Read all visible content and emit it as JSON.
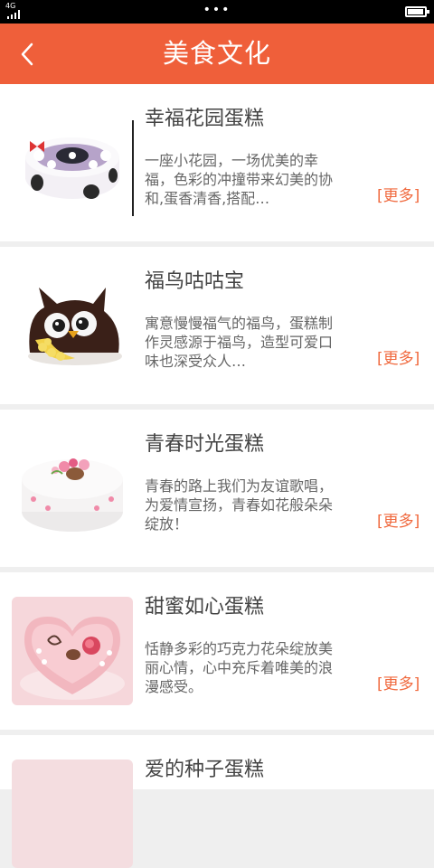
{
  "status_bar": {
    "network": "4G",
    "dots": "•••",
    "battery_level": 0.95
  },
  "header": {
    "title": "美食文化",
    "back_icon": "chevron-left-icon"
  },
  "colors": {
    "accent": "#ef5f3a",
    "more_link": "#f0693e",
    "background": "#efefef"
  },
  "items": [
    {
      "title": "幸福花园蛋糕",
      "desc": "一座小花园，一场优美的幸福，色彩的冲撞带来幻美的协和,蛋香清香,搭配…",
      "more": "[更多]",
      "image": "flower-garden-cake-image"
    },
    {
      "title": "福鸟咕咕宝",
      "desc": "寓意慢慢福气的福鸟，蛋糕制作灵感源于福鸟，造型可爱口味也深受众人…",
      "more": "[更多]",
      "image": "owl-cake-image"
    },
    {
      "title": "青春时光蛋糕",
      "desc": "青春的路上我们为友谊歌唱，为爱情宣扬，青春如花般朵朵绽放！",
      "more": "[更多]",
      "image": "youth-cake-image"
    },
    {
      "title": "甜蜜如心蛋糕",
      "desc": "恬静多彩的巧克力花朵绽放美丽心情，心中充斥着唯美的浪漫感受。",
      "more": "[更多]",
      "image": "heart-cake-image"
    },
    {
      "title": "爱的种子蛋糕"
    }
  ]
}
